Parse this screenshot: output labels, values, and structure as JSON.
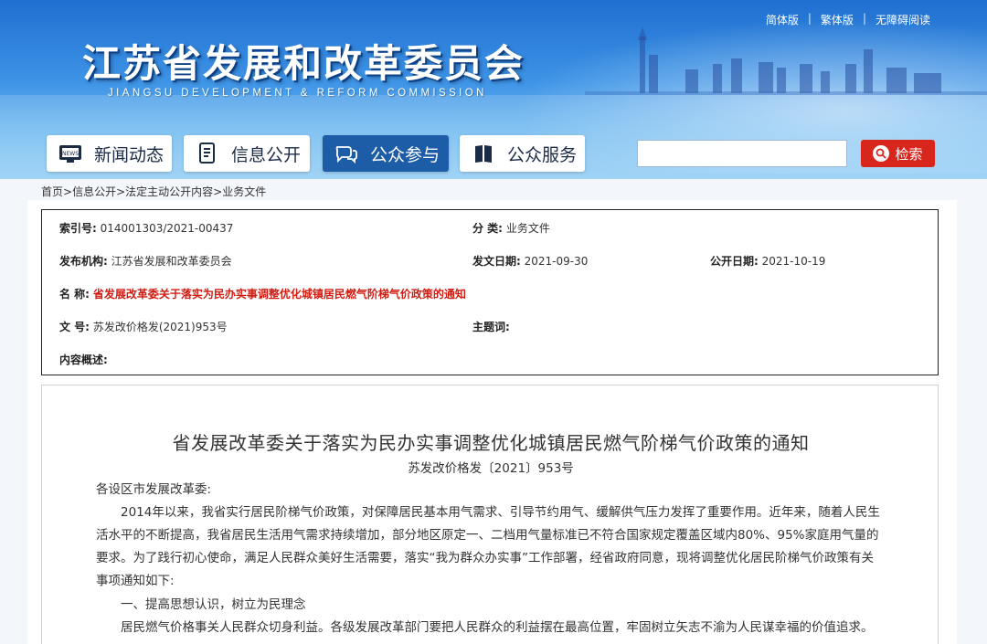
{
  "header": {
    "title": "江苏省发展和改革委员会",
    "subtitle": "JIANGSU DEVELOPMENT & REFORM COMMISSION",
    "top_links": [
      "简体版",
      "繁体版",
      "无障碍阅读"
    ],
    "separator": "|"
  },
  "nav": [
    {
      "label": "新闻动态",
      "icon": "news-icon"
    },
    {
      "label": "信息公开",
      "icon": "document-icon"
    },
    {
      "label": "公众参与",
      "icon": "chat-bubbles-icon",
      "active": true
    },
    {
      "label": "公众服务",
      "icon": "book-icon"
    }
  ],
  "search": {
    "placeholder": "",
    "button_label": "检索"
  },
  "breadcrumb": [
    "首页",
    "信息公开",
    "法定主动公开内容",
    "业务文件"
  ],
  "breadcrumb_sep": ">",
  "info": {
    "index_label": "索引号:",
    "index_value": "014001303/2021-00437",
    "category_label": "分  类:",
    "category_value": "业务文件",
    "publisher_label": "发布机构:",
    "publisher_value": "江苏省发展和改革委员会",
    "issue_date_label": "发文日期:",
    "issue_date_value": "2021-09-30",
    "public_date_label": "公开日期:",
    "public_date_value": "2021-10-19",
    "name_label": "名  称:",
    "name_value": "省发展改革委关于落实为民办实事调整优化城镇居民燃气阶梯气价政策的通知",
    "docno_label": "文  号:",
    "docno_value": "苏发改价格发(2021)953号",
    "subject_label": "主题词:",
    "subject_value": "",
    "summary_label": "内容概述:",
    "summary_value": ""
  },
  "article": {
    "title": "省发展改革委关于落实为民办实事调整优化城镇居民燃气阶梯气价政策的通知",
    "doc_number": "苏发改价格发〔2021〕953号",
    "salutation": "各设区市发展改革委:",
    "para1_line1": "2014年以来，我省实行居民阶梯气价政策，对保障居民基本用气需求、引导节约用气、缓解供气压力发挥了重要作用。近年来，随着人民生",
    "para1_line2": "活水平的不断提高，我省居民生活用气需求持续增加，部分地区原定一、二档用气量标准已不符合国家规定覆盖区域内80%、95%家庭用气量的",
    "para1_line3": "要求。为了践行初心使命，满足人民群众美好生活需要，落实“我为群众办实事”工作部署，经省政府同意，现将调整优化居民阶梯气价政策有关",
    "para1_line4": "事项通知如下:",
    "section1": "一、提高思想认识，树立为民理念",
    "para2_line1": "居民燃气价格事关人民群众切身利益。各级发展改革部门要把人民群众的利益摆在最高位置，牢固树立矢志不渝为人民谋幸福的价值追求。"
  }
}
